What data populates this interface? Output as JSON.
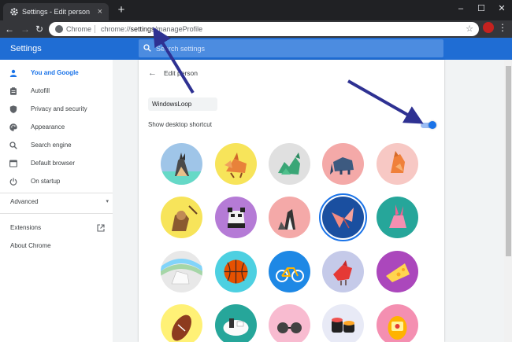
{
  "window": {
    "tab_title": "Settings - Edit person",
    "tab_close": "×",
    "new_tab": "+",
    "minimize": "–",
    "maximize": "☐",
    "close": "✕"
  },
  "toolbar": {
    "back": "←",
    "forward": "→",
    "reload": "↻",
    "url_scheme_label": "Chrome",
    "url_prefix": "chrome://",
    "url_host": "settings",
    "url_path": "/manageProfile",
    "star": "☆",
    "menu": "⋮"
  },
  "header": {
    "title": "Settings",
    "search_placeholder": "Search settings"
  },
  "sidebar": {
    "items": [
      {
        "label": "You and Google",
        "icon": "person-icon",
        "active": true
      },
      {
        "label": "Autofill",
        "icon": "clipboard-icon"
      },
      {
        "label": "Privacy and security",
        "icon": "shield-icon"
      },
      {
        "label": "Appearance",
        "icon": "palette-icon"
      },
      {
        "label": "Search engine",
        "icon": "search-icon"
      },
      {
        "label": "Default browser",
        "icon": "browser-icon"
      },
      {
        "label": "On startup",
        "icon": "power-icon"
      }
    ],
    "advanced": "Advanced",
    "advanced_chevron": "▾",
    "extensions": "Extensions",
    "about": "About Chrome"
  },
  "main": {
    "back": "←",
    "title": "Edit person",
    "name_value": "WindowsLoop",
    "shortcut_label": "Show desktop shortcut",
    "shortcut_on": true,
    "avatars": [
      "cat",
      "fox",
      "dragon",
      "elephant",
      "fox-origami",
      "monkey",
      "panda",
      "penguin",
      "butterfly",
      "rabbit",
      "unicorn",
      "basketball",
      "bicycle",
      "bird",
      "cheese",
      "football",
      "sushi-plate",
      "sunglasses",
      "sushi",
      "egg-toy"
    ],
    "selected_avatar": "butterfly"
  },
  "colors": {
    "accent": "#1a73e8",
    "header": "#1f6dd4",
    "annotation_arrow": "#2e3192"
  }
}
